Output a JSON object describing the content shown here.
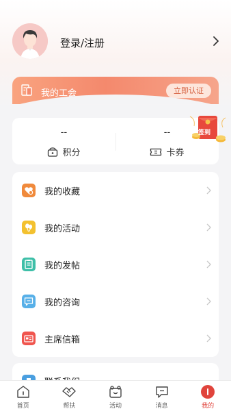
{
  "profile": {
    "login_label": "登录/注册"
  },
  "union": {
    "label": "我的工会",
    "certify_button": "立即认证"
  },
  "stats": {
    "points": {
      "value": "--",
      "label": "积分"
    },
    "coupons": {
      "value": "--",
      "label": "卡券"
    }
  },
  "signin": {
    "label": "签到"
  },
  "menu": {
    "items": [
      {
        "label": "我的收藏",
        "icon": "heart-folder-icon",
        "color": "#f08a3c"
      },
      {
        "label": "我的活动",
        "icon": "balloon-icon",
        "color": "#f3c12f"
      },
      {
        "label": "我的发帖",
        "icon": "post-icon",
        "color": "#3ebfa8"
      },
      {
        "label": "我的咨询",
        "icon": "chat-icon",
        "color": "#58b0e8"
      },
      {
        "label": "主席信箱",
        "icon": "mailbox-icon",
        "color": "#f0564f"
      }
    ]
  },
  "contact": {
    "label": "联系我们",
    "icon": "phone-icon",
    "color": "#4a9fe0"
  },
  "tabbar": {
    "tabs": [
      {
        "label": "首页",
        "icon": "home-icon"
      },
      {
        "label": "帮扶",
        "icon": "handshake-icon"
      },
      {
        "label": "活动",
        "icon": "activity-icon"
      },
      {
        "label": "消息",
        "icon": "message-icon"
      },
      {
        "label": "我的",
        "icon": "profile-icon",
        "active": true
      }
    ]
  },
  "colors": {
    "accent": "#e0443c",
    "banner": "#f4896d"
  }
}
